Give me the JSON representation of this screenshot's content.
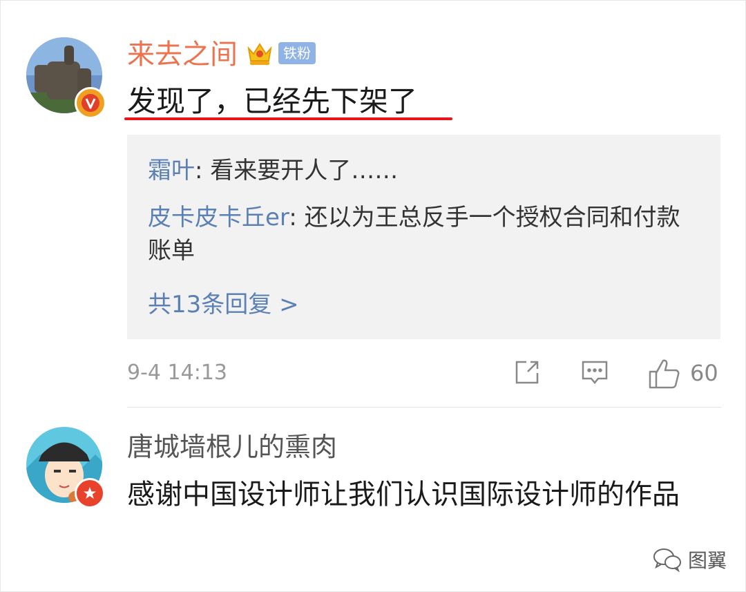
{
  "comment1": {
    "username": "来去之间",
    "crown_icon": "crown-icon",
    "fan_tag": "铁粉",
    "text": "发现了，已经先下架了",
    "replies": [
      {
        "author": "霜叶",
        "text": ": 看来要开人了……"
      },
      {
        "author": "皮卡皮卡丘er",
        "text": ": 还以为王总反手一个授权合同和付款账单"
      }
    ],
    "more_replies": "共13条回复 >",
    "time": "9-4 14:13",
    "like_count": "60"
  },
  "comment2": {
    "username": "唐城墙根儿的熏肉",
    "text": "感谢中国设计师让我们认识国际设计师的作品"
  },
  "watermark": "图翼",
  "colors": {
    "username_orange": "#eb7350",
    "link_blue": "#5a80b5",
    "underline_red": "#e8151b",
    "tag_blue": "#8fb3e6",
    "reply_bg": "#f2f2f2"
  }
}
